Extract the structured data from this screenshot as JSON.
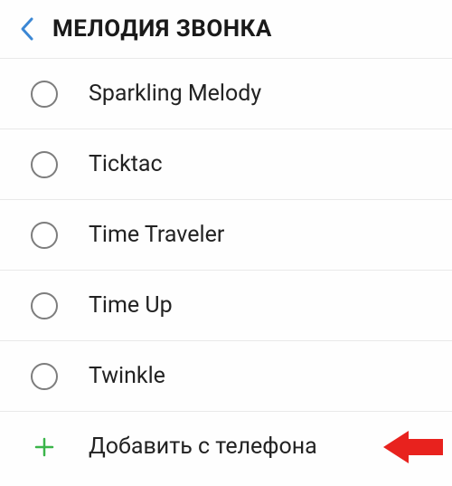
{
  "header": {
    "title": "МЕЛОДИЯ ЗВОНКА"
  },
  "ringtones": [
    {
      "label": "Sparkling Melody"
    },
    {
      "label": "Ticktac"
    },
    {
      "label": "Time Traveler"
    },
    {
      "label": "Time Up"
    },
    {
      "label": "Twinkle"
    }
  ],
  "add_from_phone": {
    "label": "Добавить с телефона"
  },
  "colors": {
    "back_arrow": "#3b87d4",
    "plus_icon": "#3bb54a",
    "annotation_arrow": "#e8221e",
    "divider": "#e9e9e9",
    "radio_border": "#7d7d7d"
  }
}
